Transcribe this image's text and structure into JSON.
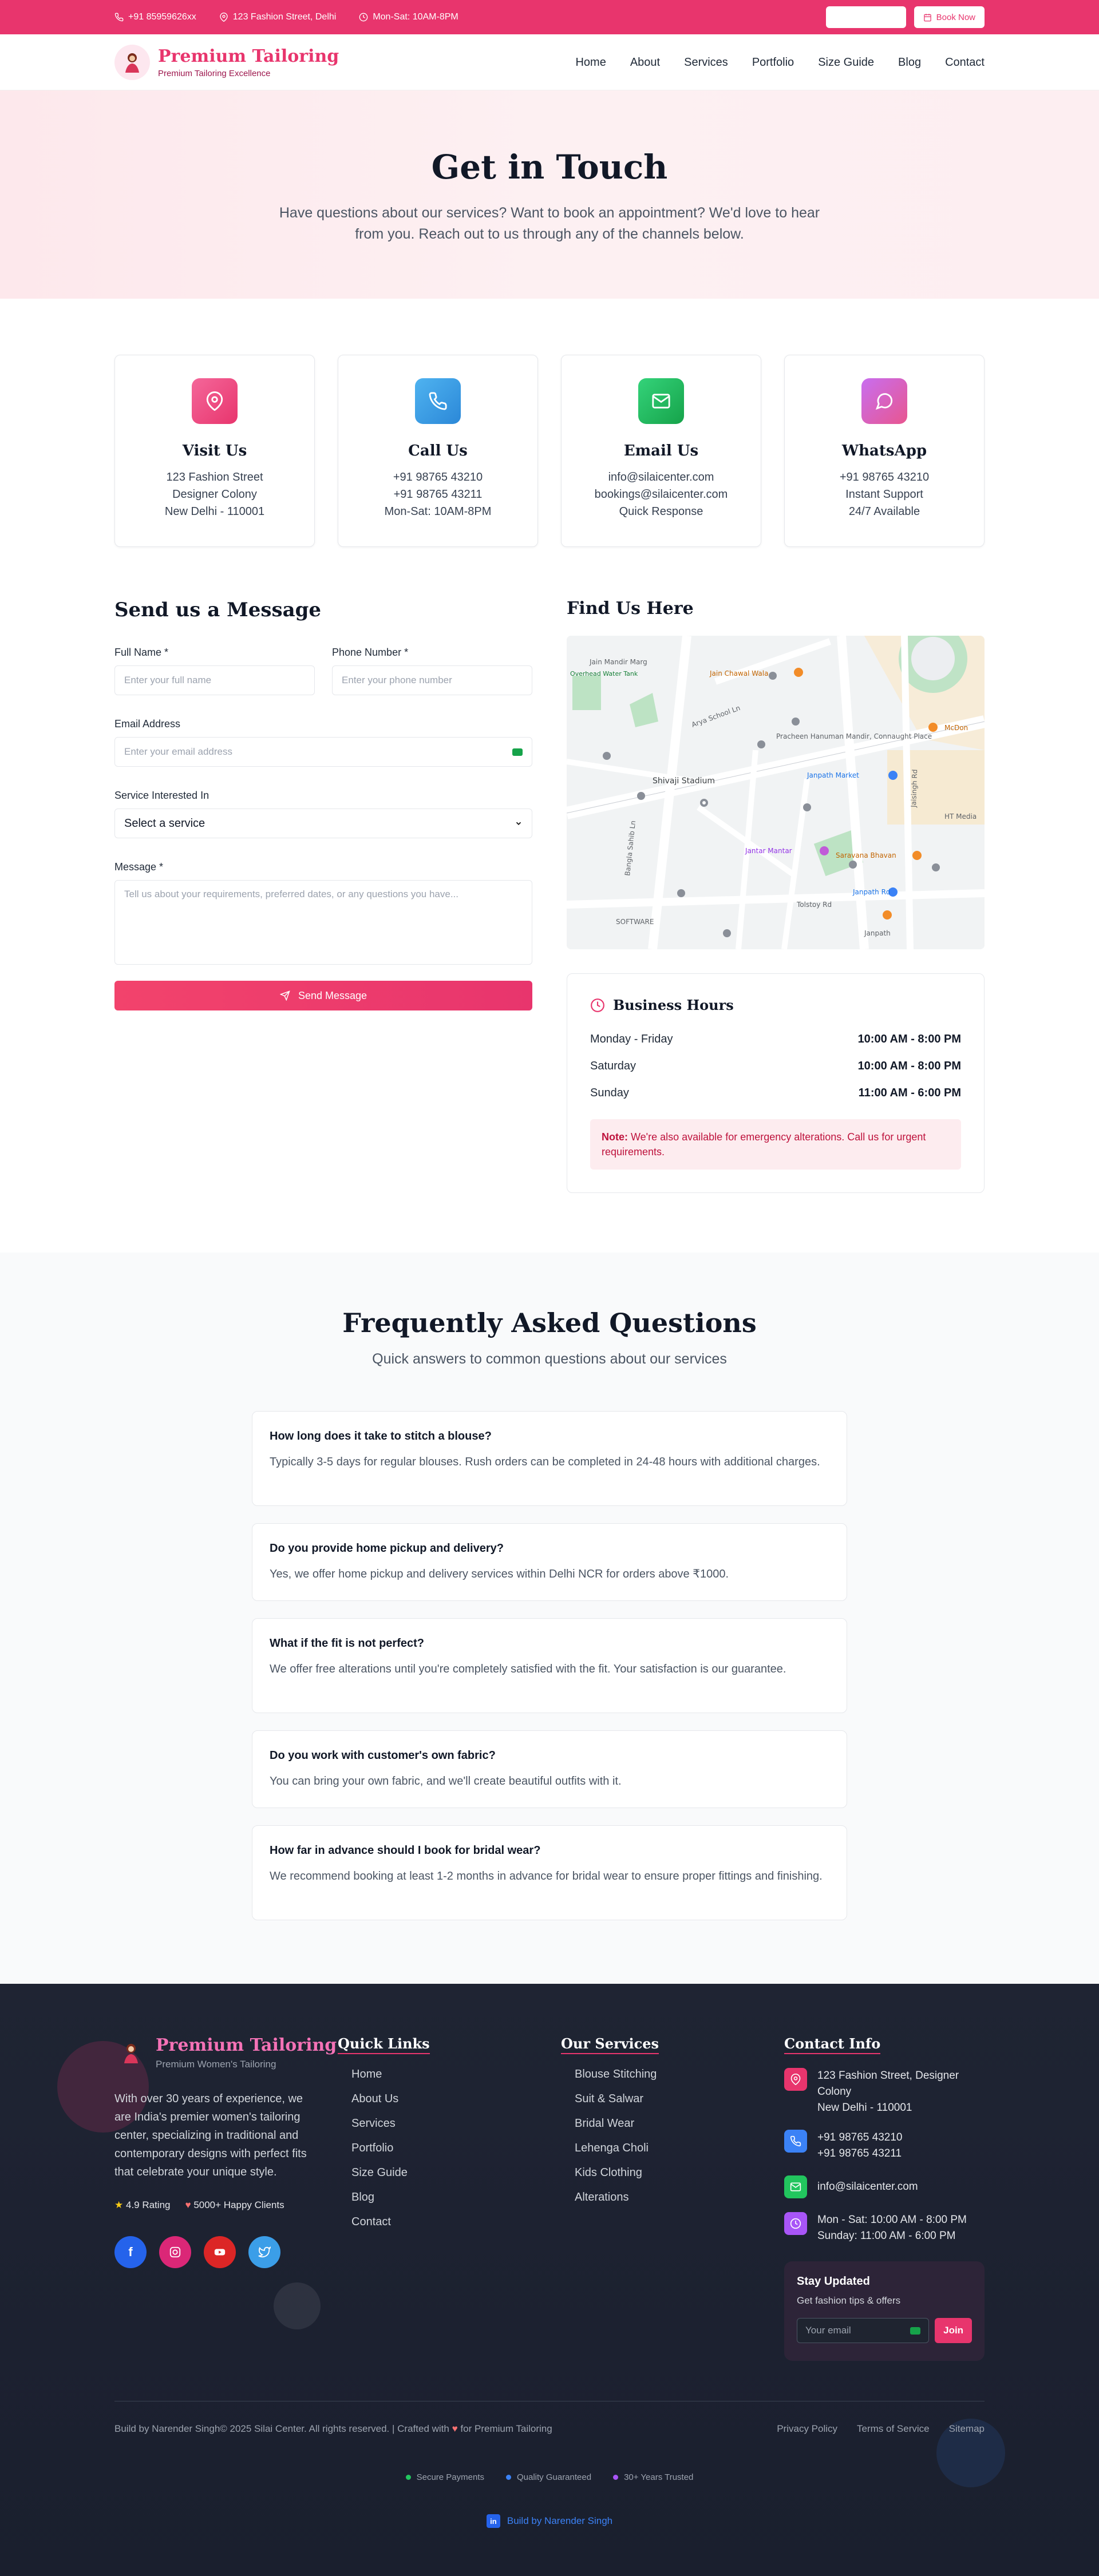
{
  "topbar": {
    "phone": "+91 85959626xx",
    "address": "123 Fashion Street, Delhi",
    "hours": "Mon-Sat: 10AM-8PM",
    "book_label": "Book Now"
  },
  "brand": {
    "name": "Premium Tailoring",
    "tagline": "Premium Tailoring Excellence"
  },
  "nav": [
    "Home",
    "About",
    "Services",
    "Portfolio",
    "Size Guide",
    "Blog",
    "Contact"
  ],
  "hero": {
    "title": "Get in Touch",
    "subtitle": "Have questions about our services? Want to book an appointment? We'd love to hear from you. Reach out to us through any of the channels below."
  },
  "cards": [
    {
      "title": "Visit Us",
      "lines": [
        "123 Fashion Street",
        "Designer Colony",
        "New Delhi - 110001"
      ],
      "icon": "map-pin-icon",
      "color": "#f0508a"
    },
    {
      "title": "Call Us",
      "lines": [
        "+91 98765 43210",
        "+91 98765 43211",
        "Mon-Sat: 10AM-8PM"
      ],
      "icon": "phone-icon",
      "color": "#3b9ee8"
    },
    {
      "title": "Email Us",
      "lines": [
        "info@silaicenter.com",
        "bookings@silaicenter.com",
        "Quick Response"
      ],
      "icon": "mail-icon",
      "color": "#22c55e"
    },
    {
      "title": "WhatsApp",
      "lines": [
        "+91 98765 43210",
        "Instant Support",
        "24/7 Available"
      ],
      "icon": "chat-icon",
      "color": "#b05ce8"
    }
  ],
  "form": {
    "title": "Send us a Message",
    "name_label": "Full Name *",
    "name_placeholder": "Enter your full name",
    "phone_label": "Phone Number *",
    "phone_placeholder": "Enter your phone number",
    "email_label": "Email Address",
    "email_placeholder": "Enter your email address",
    "service_label": "Service Interested In",
    "service_value": "Select a service",
    "message_label": "Message *",
    "message_placeholder": "Tell us about your requirements, preferred dates, or any questions you have...",
    "send_label": "Send Message"
  },
  "map": {
    "title": "Find Us Here",
    "labels": [
      "Jain Mandir Marg",
      "Overhead Water Tank",
      "Jain Chawal Wala",
      "Arya School Ln",
      "Pracheen Hanuman Mandir, Connaught Place",
      "Janpath Market",
      "Shivaji Stadium",
      "Jantar Mantar",
      "Saravana Bhavan",
      "Janpath Rd",
      "Tolstoy Rd",
      "SOFTWARE",
      "Janpath",
      "McDon",
      "Bangla Sahib Ln",
      "Jaisingh Rd",
      "HT Media"
    ]
  },
  "hours": {
    "title": "Business Hours",
    "rows": [
      {
        "day": "Monday - Friday",
        "time": "10:00 AM - 8:00 PM"
      },
      {
        "day": "Saturday",
        "time": "10:00 AM - 8:00 PM"
      },
      {
        "day": "Sunday",
        "time": "11:00 AM - 6:00 PM"
      }
    ],
    "note_bold": "Note:",
    "note_text": " We're also available for emergency alterations. Call us for urgent requirements."
  },
  "faq": {
    "title": "Frequently Asked Questions",
    "subtitle": "Quick answers to common questions about our services",
    "items": [
      {
        "q": "How long does it take to stitch a blouse?",
        "a": "Typically 3-5 days for regular blouses. Rush orders can be completed in 24-48 hours with additional charges."
      },
      {
        "q": "Do you provide home pickup and delivery?",
        "a": "Yes, we offer home pickup and delivery services within Delhi NCR for orders above ₹1000."
      },
      {
        "q": "What if the fit is not perfect?",
        "a": "We offer free alterations until you're completely satisfied with the fit. Your satisfaction is our guarantee."
      },
      {
        "q": "Do you work with customer's own fabric?",
        "a": "You can bring your own fabric, and we'll create beautiful outfits with it."
      },
      {
        "q": "How far in advance should I book for bridal wear?",
        "a": "We recommend booking at least 1-2 months in advance for bridal wear to ensure proper fittings and finishing."
      }
    ]
  },
  "footer": {
    "brand": "Premium Tailoring",
    "tag": "Premium Women's Tailoring",
    "desc": "With over 30 years of experience, we are India's premier women's tailoring center, specializing in traditional and contemporary designs with perfect fits that celebrate your unique style.",
    "rating": "4.9 Rating",
    "clients": "5000+ Happy Clients",
    "quick_title": "Quick Links",
    "quick": [
      "Home",
      "About Us",
      "Services",
      "Portfolio",
      "Size Guide",
      "Blog",
      "Contact"
    ],
    "services_title": "Our Services",
    "services": [
      "Blouse Stitching",
      "Suit & Salwar",
      "Bridal Wear",
      "Lehenga Choli",
      "Kids Clothing",
      "Alterations"
    ],
    "contact_title": "Contact Info",
    "address": "123 Fashion Street, Designer Colony\nNew Delhi - 110001",
    "phone1": "+91 98765 43210",
    "phone2": "+91 98765 43211",
    "email": "info@silaicenter.com",
    "hours1": "Mon - Sat: 10:00 AM - 8:00 PM",
    "hours2": "Sunday: 11:00 AM - 6:00 PM",
    "stay_title": "Stay Updated",
    "stay_sub": "Get fashion tips & offers",
    "email_placeholder": "Your email",
    "join_label": "Join",
    "copyright": "Build by Narender Singh© 2025 Silai Center. All rights reserved. | Crafted with",
    "crafted_for": "for Premium Tailoring",
    "legal": [
      "Privacy Policy",
      "Terms of Service",
      "Sitemap"
    ],
    "badges": [
      {
        "label": "Secure Payments",
        "color": "#22c55e"
      },
      {
        "label": "Quality Guaranteed",
        "color": "#3b82f6"
      },
      {
        "label": "30+ Years Trusted",
        "color": "#a855f7"
      }
    ],
    "credit": "Build by Narender Singh"
  }
}
